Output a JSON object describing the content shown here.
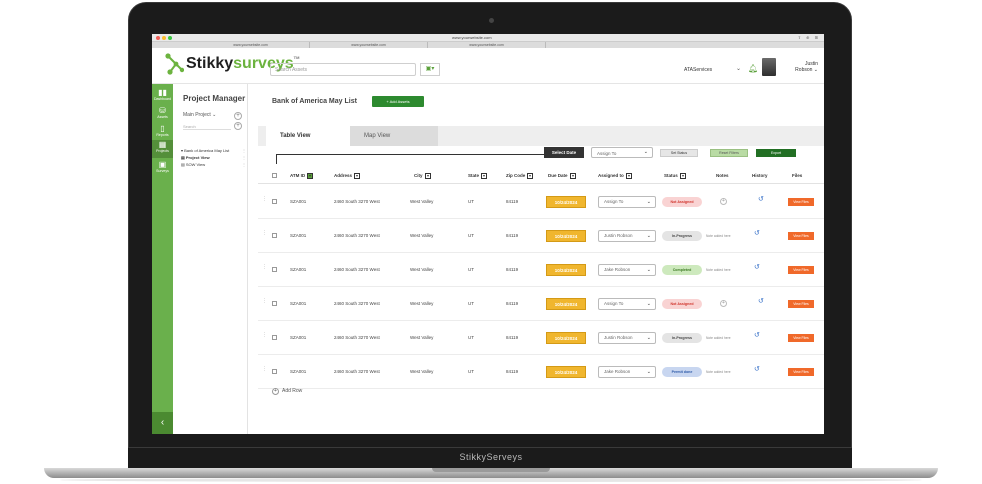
{
  "browser": {
    "url": "www.yourwebsite.com",
    "tabs": [
      "www.yourwebsite.com",
      "www.yourwebsite.com",
      "www.yourwebsite.com"
    ]
  },
  "header": {
    "logo_part1": "Stikky",
    "logo_part2": "surveys",
    "logo_tm": "TM",
    "search_placeholder": "Search Assets",
    "org": "ATAServices",
    "user_first": "Justin",
    "user_last": "Robson"
  },
  "rail": {
    "items": [
      {
        "label": "Dashboard",
        "icon": "bar-chart-icon"
      },
      {
        "label": "Assets",
        "icon": "database-icon"
      },
      {
        "label": "Reports",
        "icon": "report-icon"
      },
      {
        "label": "Projects",
        "icon": "grid-icon"
      },
      {
        "label": "Surveys",
        "icon": "clipboard-icon"
      }
    ]
  },
  "project_manager": {
    "title": "Project Manager",
    "main_project": "Main Project",
    "search": "Search",
    "tree_root": "Bank of America May List",
    "tree_items": [
      "Project View",
      "SOW View"
    ]
  },
  "main": {
    "list_title": "Bank of America May List",
    "add_assets": "+ Add Assets",
    "tabs": [
      "Table View",
      "Map View"
    ]
  },
  "toolbar": {
    "select_date": "Select Date",
    "assign_to": "Assign To",
    "set_status": "Set Status",
    "reset_filters": "Reset Filters",
    "export": "Export"
  },
  "table": {
    "headers": [
      "ATM ID",
      "Address",
      "City",
      "State",
      "Zip Code",
      "Due Date",
      "Assigned to",
      "Status",
      "Notes",
      "History",
      "Files"
    ],
    "rows": [
      {
        "atm": "SZA001",
        "address": "2460 South 3270 West",
        "city": "West Valley",
        "state": "UT",
        "zip": "84119",
        "due": "10/24/2024",
        "assigned": "Assign To",
        "status": "Not Assigned",
        "note": ""
      },
      {
        "atm": "SZA001",
        "address": "2460 South 3270 West",
        "city": "West Valley",
        "state": "UT",
        "zip": "84119",
        "due": "10/24/2024",
        "assigned": "Justin Robson",
        "status": "In-Progress",
        "note": "Note added here"
      },
      {
        "atm": "SZA001",
        "address": "2460 South 3270 West",
        "city": "West Valley",
        "state": "UT",
        "zip": "84119",
        "due": "10/24/2024",
        "assigned": "Jake Robson",
        "status": "Completed",
        "note": "Note added here"
      },
      {
        "atm": "SZA001",
        "address": "2460 South 3270 West",
        "city": "West Valley",
        "state": "UT",
        "zip": "84119",
        "due": "10/24/2024",
        "assigned": "Assign To",
        "status": "Not Assigned",
        "note": ""
      },
      {
        "atm": "SZA001",
        "address": "2460 South 3270 West",
        "city": "West Valley",
        "state": "UT",
        "zip": "84119",
        "due": "10/24/2024",
        "assigned": "Justin Robson",
        "status": "In-Progress",
        "note": "Note added here"
      },
      {
        "atm": "SZA001",
        "address": "2460 South 3270 West",
        "city": "West Valley",
        "state": "UT",
        "zip": "84119",
        "due": "10/24/2024",
        "assigned": "Jake Robson",
        "status": "Permit done",
        "note": "Note added here"
      }
    ],
    "view_files": "View Files",
    "add_row": "Add Row"
  },
  "status_colors": {
    "Not Assigned": {
      "bg": "#f9d3d3",
      "fg": "#d0342c"
    },
    "In-Progress": {
      "bg": "#e4e4e4",
      "fg": "#444444"
    },
    "Completed": {
      "bg": "#cde9bd",
      "fg": "#3c7a22"
    },
    "Permit done": {
      "bg": "#c8d6f0",
      "fg": "#2e5aa8"
    }
  },
  "laptop_brand": "StikkyServeys",
  "colors": {
    "accent": "#6ab04c",
    "dark_green": "#226f24",
    "due": "#f0b62e",
    "files": "#f0692a"
  }
}
